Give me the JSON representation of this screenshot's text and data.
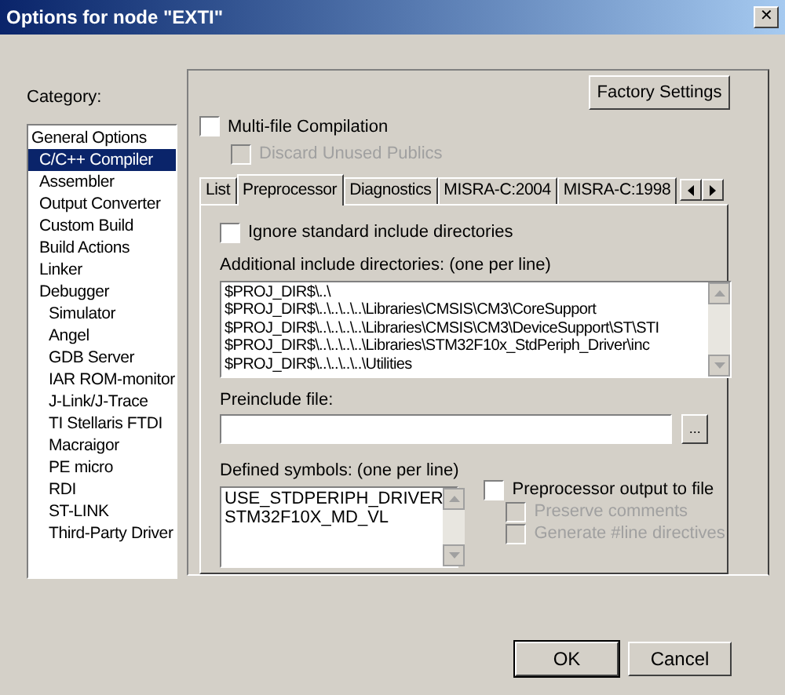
{
  "window": {
    "title": "Options for node \"EXTI\"",
    "close": "✕"
  },
  "category": {
    "label": "Category:",
    "items": [
      {
        "label": "General Options",
        "selected": false
      },
      {
        "label": "C/C++ Compiler",
        "selected": true
      },
      {
        "label": "Assembler",
        "selected": false
      },
      {
        "label": "Output Converter",
        "selected": false
      },
      {
        "label": "Custom Build",
        "selected": false
      },
      {
        "label": "Build Actions",
        "selected": false
      },
      {
        "label": "Linker",
        "selected": false
      },
      {
        "label": "Debugger",
        "selected": false,
        "children": [
          {
            "label": "Simulator",
            "selected": false
          },
          {
            "label": "Angel",
            "selected": false
          },
          {
            "label": "GDB Server",
            "selected": false
          },
          {
            "label": "IAR ROM-monitor",
            "selected": false
          },
          {
            "label": "J-Link/J-Trace",
            "selected": false
          },
          {
            "label": "TI Stellaris FTDI",
            "selected": false
          },
          {
            "label": "Macraigor",
            "selected": false
          },
          {
            "label": "PE micro",
            "selected": false
          },
          {
            "label": "RDI",
            "selected": false
          },
          {
            "label": "ST-LINK",
            "selected": false
          },
          {
            "label": "Third-Party Driver",
            "selected": false
          }
        ]
      }
    ]
  },
  "factory_button": "Factory Settings",
  "top_options": [
    {
      "label": "Multi-file Compilation",
      "checked": false,
      "disabled": false
    },
    {
      "label": "Discard Unused Publics",
      "checked": false,
      "disabled": true
    }
  ],
  "tabs": [
    {
      "label": "List",
      "selected": false
    },
    {
      "label": "Preprocessor",
      "selected": true
    },
    {
      "label": "Diagnostics",
      "selected": false
    },
    {
      "label": "MISRA-C:2004",
      "selected": false
    },
    {
      "label": "MISRA-C:1998",
      "selected": false
    }
  ],
  "ignore_std": {
    "label": "Ignore standard include directories",
    "checked": false,
    "disabled": false
  },
  "include_dirs": {
    "label": "Additional include directories: (one per line)",
    "lines": [
      "$PROJ_DIR$\\..\\",
      "$PROJ_DIR$\\..\\..\\..\\..\\Libraries\\CMSIS\\CM3\\CoreSupport",
      "$PROJ_DIR$\\..\\..\\..\\..\\Libraries\\CMSIS\\CM3\\DeviceSupport\\ST\\STI",
      "$PROJ_DIR$\\..\\..\\..\\..\\Libraries\\STM32F10x_StdPeriph_Driver\\inc",
      "$PROJ_DIR$\\..\\..\\..\\..\\Utilities"
    ]
  },
  "preinclude": {
    "label": "Preinclude file:",
    "browse": "..."
  },
  "defined_symbols": {
    "label": "Defined symbols: (one per line)",
    "lines": [
      "USE_STDPERIPH_DRIVER",
      "STM32F10X_MD_VL"
    ]
  },
  "output_options": [
    {
      "label": "Preprocessor output to file",
      "checked": false,
      "disabled": false,
      "indent": false
    },
    {
      "label": "Preserve comments",
      "checked": false,
      "disabled": true,
      "indent": true
    },
    {
      "label": "Generate #line directives",
      "checked": false,
      "disabled": true,
      "indent": true
    }
  ],
  "buttons": [
    {
      "label": "OK",
      "default": true
    },
    {
      "label": "Cancel",
      "default": false
    }
  ]
}
